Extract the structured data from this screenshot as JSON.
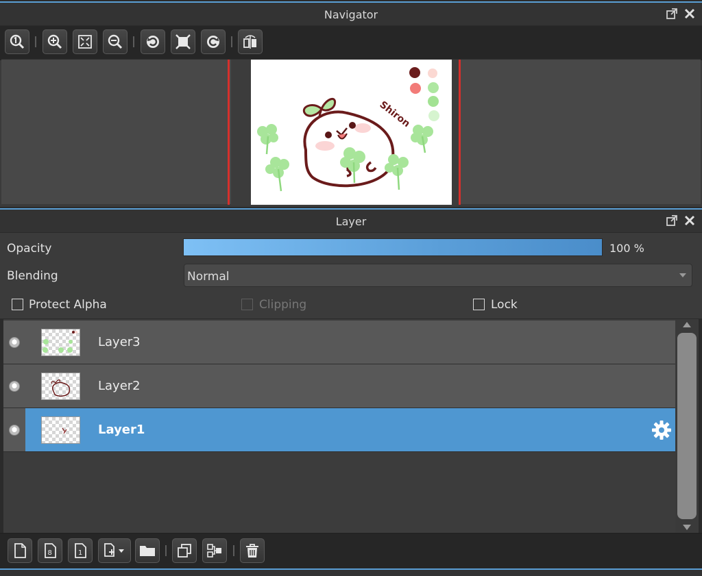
{
  "navigator": {
    "title": "Navigator",
    "toolbar": [
      "actual-size",
      "zoom-in",
      "fit-window",
      "zoom-out",
      "rotate-left",
      "reset-view",
      "rotate-right",
      "flip-horizontal"
    ]
  },
  "canvas_art": {
    "signature": "Shiron"
  },
  "layer_panel": {
    "title": "Layer",
    "opacity_label": "Opacity",
    "opacity_value": "100 %",
    "opacity_fraction": 1.0,
    "blending_label": "Blending",
    "blending_value": "Normal",
    "protect_alpha_label": "Protect Alpha",
    "clipping_label": "Clipping",
    "lock_label": "Lock",
    "layers": [
      {
        "name": "Layer3",
        "selected": false
      },
      {
        "name": "Layer2",
        "selected": false
      },
      {
        "name": "Layer1",
        "selected": true
      }
    ],
    "bottom_tools": [
      "new-layer",
      "new-8bit-layer",
      "new-1bit-layer",
      "add-layer-menu",
      "new-folder",
      "duplicate-layer",
      "merge-down",
      "delete-layer"
    ]
  },
  "colors": {
    "accent": "#5a9fd6",
    "selected_row": "#4f97d1",
    "panel_bg": "#3b3b3b"
  }
}
